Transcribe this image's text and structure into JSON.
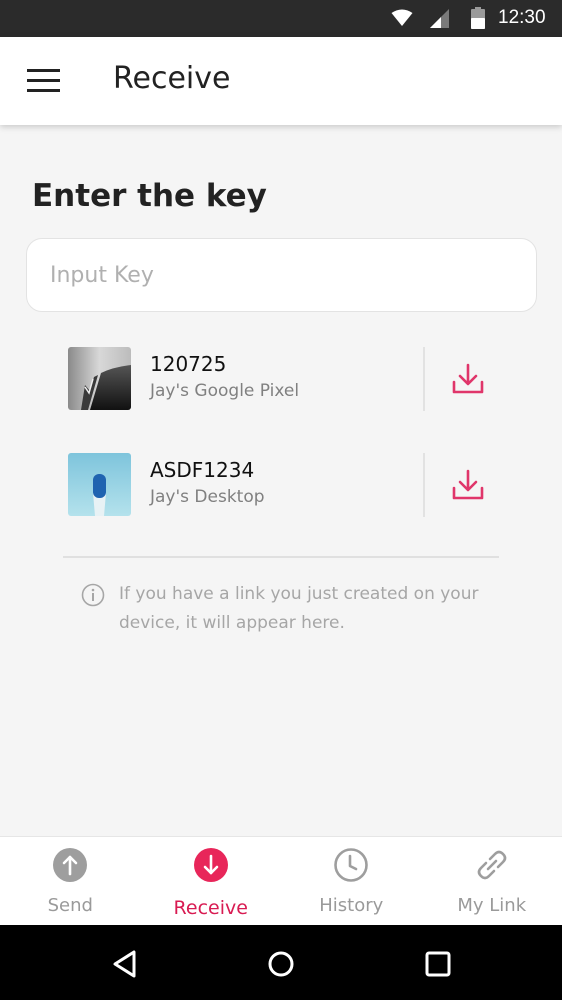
{
  "status_bar": {
    "time": "12:30",
    "icons": [
      "wifi-icon",
      "cell-signal-icon",
      "battery-icon"
    ]
  },
  "app_bar": {
    "menu_icon": "hamburger-menu-icon",
    "title": "Receive"
  },
  "main": {
    "heading": "Enter the key",
    "key_input": {
      "placeholder": "Input Key",
      "value": ""
    },
    "recent_links": [
      {
        "key": "120725",
        "device": "Jay's Google Pixel",
        "thumbnail": "grayscale-architecture-photo",
        "action_icon": "download-icon"
      },
      {
        "key": "ASDF1234",
        "device": "Jay's Desktop",
        "thumbnail": "blue-sky-tower-photo",
        "action_icon": "download-icon"
      }
    ],
    "info_text": "If you have a link you just created on your device, it will appear here."
  },
  "bottom_nav": {
    "tabs": [
      {
        "label": "Send",
        "icon": "upload-circle-icon",
        "active": false
      },
      {
        "label": "Receive",
        "icon": "download-circle-icon",
        "active": true
      },
      {
        "label": "History",
        "icon": "clock-icon",
        "active": false
      },
      {
        "label": "My Link",
        "icon": "link-icon",
        "active": false
      }
    ]
  },
  "system_nav": {
    "buttons": [
      "back-icon",
      "home-icon",
      "recents-icon"
    ]
  },
  "colors": {
    "accent": "#e8265a",
    "accent_text": "#d81b52",
    "inactive": "#9a9a9a",
    "background": "#f5f5f5"
  }
}
